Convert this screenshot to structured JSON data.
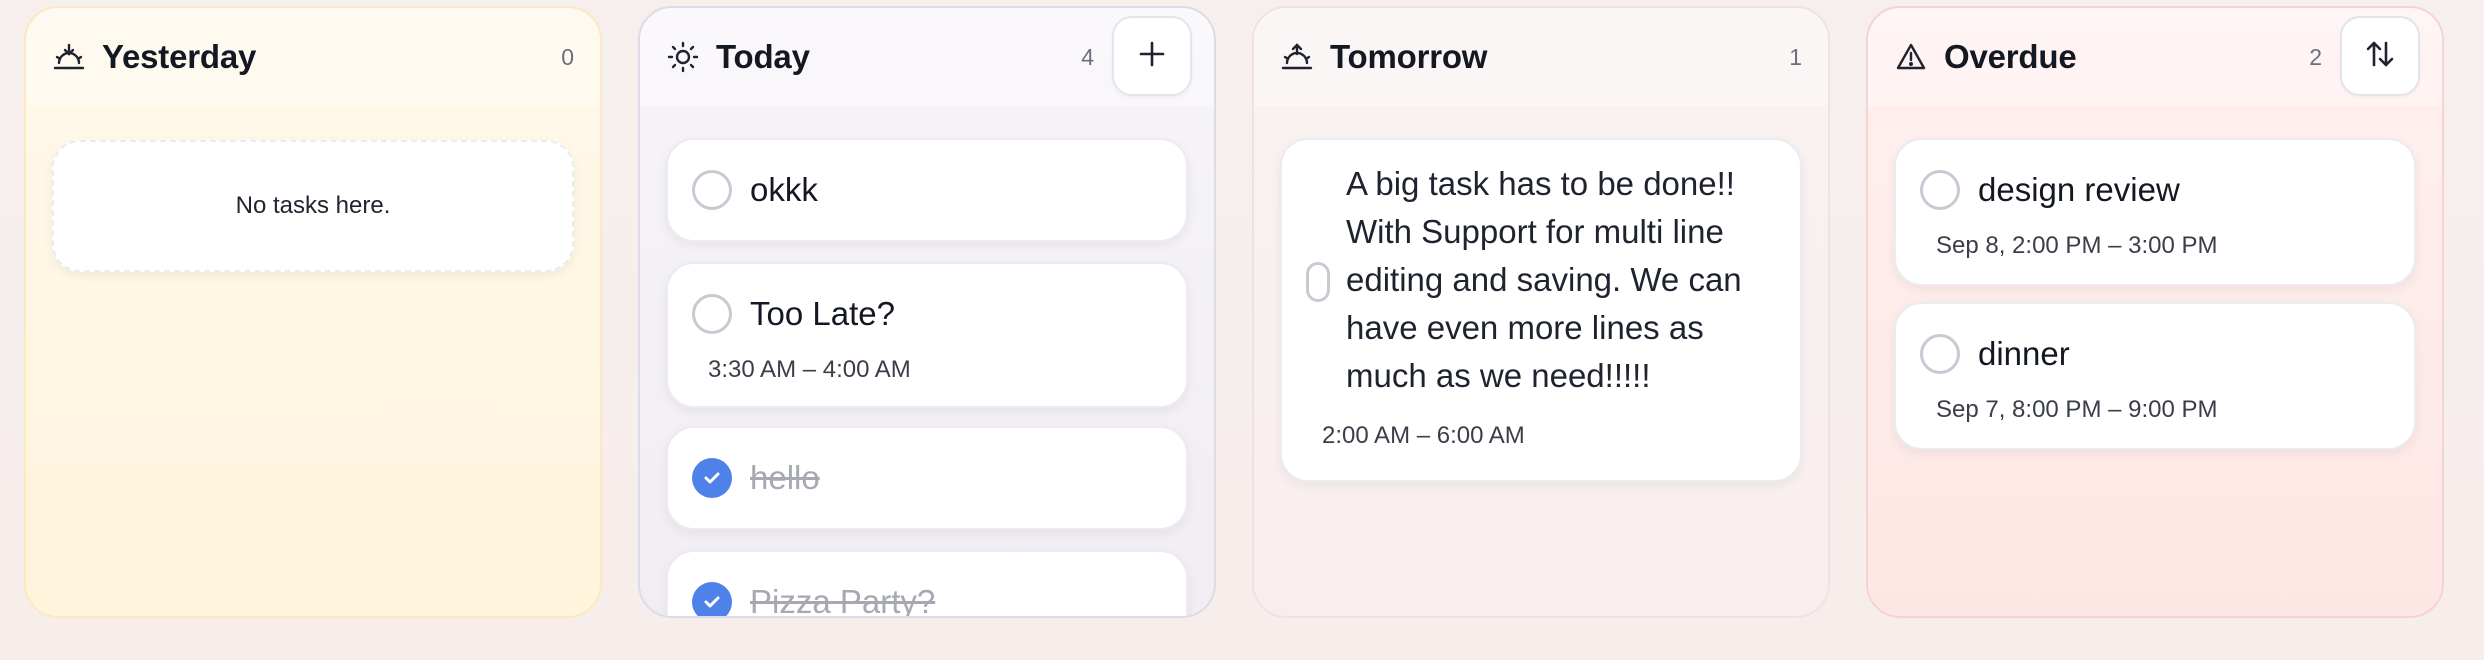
{
  "columns": {
    "yesterday": {
      "title": "Yesterday",
      "count": "0",
      "empty_text": "No tasks here."
    },
    "today": {
      "title": "Today",
      "count": "4",
      "tasks": [
        {
          "title": "okkk",
          "done": false
        },
        {
          "title": "Too Late?",
          "time": "3:30 AM – 4:00 AM",
          "done": false
        },
        {
          "title": "hello",
          "done": true
        },
        {
          "title": "Pizza Party?",
          "done": true
        }
      ]
    },
    "tomorrow": {
      "title": "Tomorrow",
      "count": "1",
      "tasks": [
        {
          "title_lines": [
            "A big task has to be done!!",
            "With Support for multi line",
            "editing and saving. We can",
            "have even more lines as",
            "much as we need!!!!!"
          ],
          "time": "2:00 AM – 6:00 AM"
        }
      ]
    },
    "overdue": {
      "title": "Overdue",
      "count": "2",
      "tasks": [
        {
          "title": "design review",
          "time": "Sep 8, 2:00 PM – 3:00 PM"
        },
        {
          "title": "dinner",
          "time": "Sep 7, 8:00 PM – 9:00 PM"
        }
      ]
    }
  },
  "icons": {
    "yesterday": "sunset-icon",
    "today": "sun-icon",
    "tomorrow": "sunrise-icon",
    "overdue": "warning-icon",
    "add": "plus-icon",
    "sort": "sort-arrows-icon"
  },
  "colors": {
    "accent": "#4f82e8",
    "yesterday_bg": "#fff6e4",
    "overdue_bg": "#fdeae8",
    "done_text": "#a6a9b3"
  }
}
